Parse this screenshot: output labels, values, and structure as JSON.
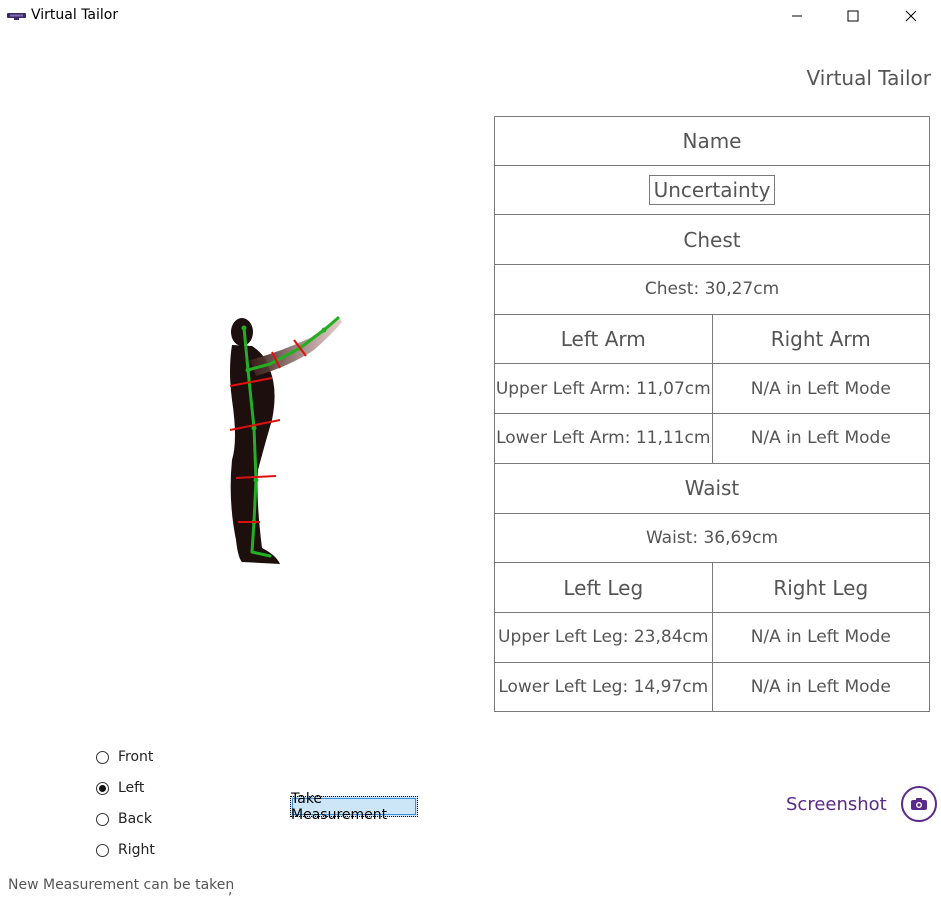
{
  "window": {
    "title": "Virtual Tailor",
    "icon": "kinect-icon",
    "controls": [
      "minimize-icon",
      "maximize-icon",
      "close-icon"
    ]
  },
  "header": {
    "title": "Virtual Tailor"
  },
  "table": {
    "name": "Name",
    "uncertainty": "Uncertainty",
    "chest_header": "Chest",
    "chest_value": "Chest: 30,27cm",
    "left_arm_header": "Left Arm",
    "right_arm_header": "Right Arm",
    "upper_left_arm": "Upper Left Arm: 11,07cm",
    "upper_right_arm": "N/A in Left Mode",
    "lower_left_arm": "Lower Left Arm: 11,11cm",
    "lower_right_arm": "N/A in Left Mode",
    "waist_header": "Waist",
    "waist_value": "Waist: 36,69cm",
    "left_leg_header": "Left Leg",
    "right_leg_header": "Right Leg",
    "upper_left_leg": "Upper Left Leg: 23,84cm",
    "upper_right_leg": "N/A in Left Mode",
    "lower_left_leg": "Lower Left Leg: 14,97cm",
    "lower_right_leg": "N/A in Left Mode"
  },
  "views": {
    "options": [
      {
        "label": "Front",
        "selected": false
      },
      {
        "label": "Left",
        "selected": true
      },
      {
        "label": "Back",
        "selected": false
      },
      {
        "label": "Right",
        "selected": false
      }
    ]
  },
  "actions": {
    "take_measurement": "Take Measurement",
    "screenshot": "Screenshot",
    "screenshot_icon": "camera-icon"
  },
  "status": {
    "message": "New Measurement can be taken",
    "tick": ","
  },
  "colors": {
    "accent": "#5a2a8a",
    "skeleton": "#22b022",
    "measure_lines": "#e01010"
  }
}
